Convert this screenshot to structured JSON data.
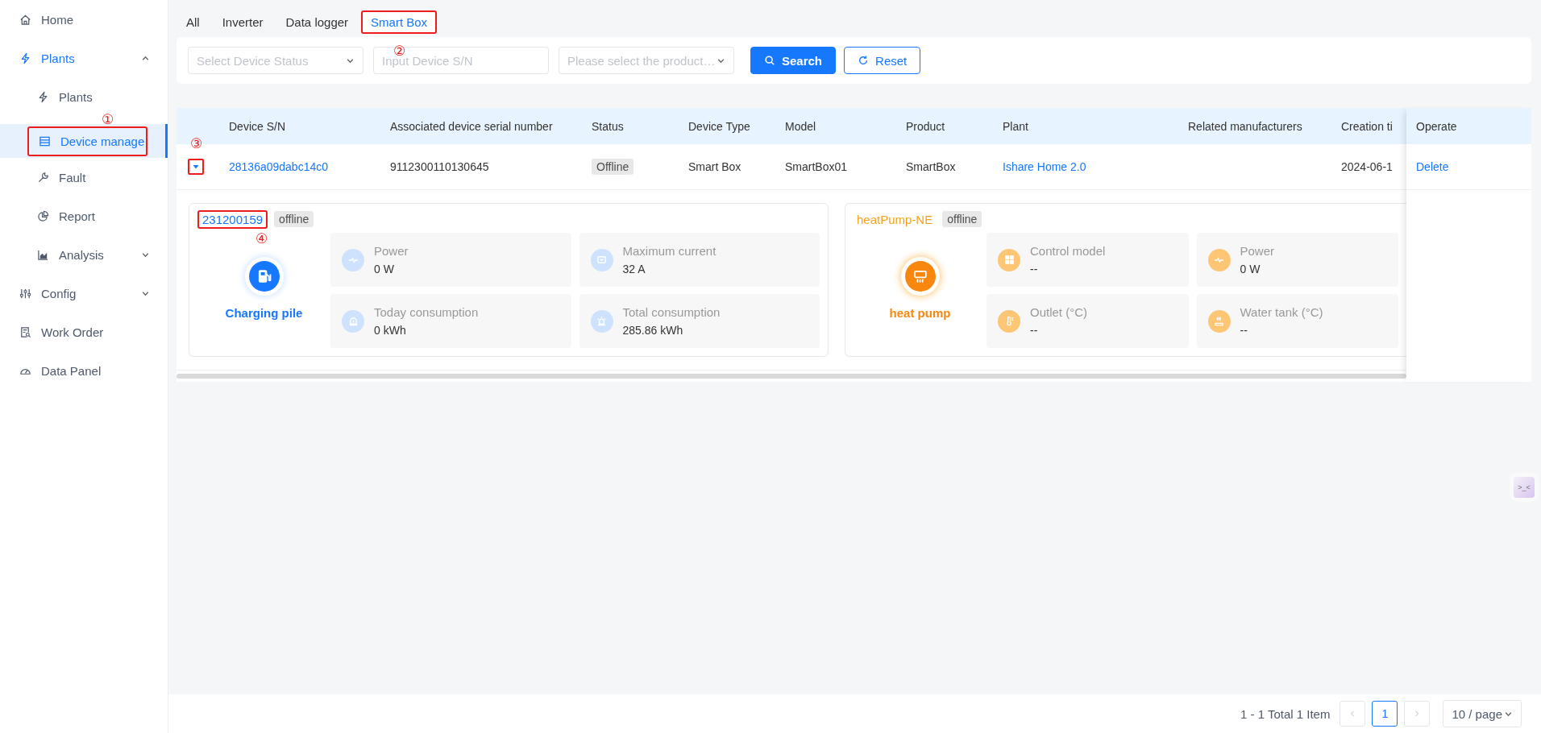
{
  "sidebar": {
    "items": [
      {
        "label": "Home",
        "selected": false
      },
      {
        "label": "Plants",
        "selected": false,
        "expanded": true,
        "children": [
          {
            "label": "Plants",
            "selected": false
          },
          {
            "label": "Device manage",
            "selected": true,
            "callout": "①"
          },
          {
            "label": "Fault",
            "selected": false
          },
          {
            "label": "Report",
            "selected": false
          },
          {
            "label": "Analysis",
            "selected": false,
            "expanded": false
          }
        ]
      },
      {
        "label": "Config",
        "selected": false,
        "expanded": false
      },
      {
        "label": "Work Order",
        "selected": false
      },
      {
        "label": "Data Panel",
        "selected": false
      }
    ]
  },
  "tabs": [
    {
      "label": "All",
      "selected": false
    },
    {
      "label": "Inverter",
      "selected": false
    },
    {
      "label": "Data logger",
      "selected": false
    },
    {
      "label": "Smart Box",
      "selected": true,
      "callout": "②"
    }
  ],
  "filters": [
    {
      "kind": "select",
      "placeholder": "Select Device Status"
    },
    {
      "kind": "input",
      "placeholder": "Input Device S/N"
    },
    {
      "kind": "select",
      "placeholder": "Please select the product…"
    }
  ],
  "buttons": [
    {
      "kind": "primary",
      "label": "Search"
    },
    {
      "kind": "default",
      "label": "Reset"
    }
  ],
  "table": {
    "columns": [
      "Device S/N",
      "Associated device serial number",
      "Status",
      "Device Type",
      "Model",
      "Product",
      "Plant",
      "Related manufacturers",
      "Creation ti"
    ],
    "operate_column": "Operate",
    "rows": [
      {
        "expanded": true,
        "callout": "③",
        "cells": [
          {
            "kind": "link",
            "text": "28136a09dabc14c0"
          },
          {
            "kind": "text",
            "text": "9112300110130645"
          },
          {
            "kind": "tag",
            "text": "Offline"
          },
          {
            "kind": "text",
            "text": "Smart Box"
          },
          {
            "kind": "text",
            "text": "SmartBox01"
          },
          {
            "kind": "text",
            "text": "SmartBox"
          },
          {
            "kind": "link",
            "text": "Ishare Home 2.0"
          },
          {
            "kind": "text",
            "text": ""
          },
          {
            "kind": "text",
            "text": "2024-06-1"
          }
        ],
        "operate": "Delete",
        "devices": [
          {
            "kind": "charger",
            "id": "231200159",
            "callout": "④",
            "status": "offline",
            "label": "Charging pile",
            "metrics": [
              {
                "label": "Power",
                "value": "0 W"
              },
              {
                "label": "Maximum current",
                "value": "32 A"
              },
              {
                "label": "Today consumption",
                "value": "0 kWh"
              },
              {
                "label": "Total consumption",
                "value": "285.86 kWh"
              }
            ]
          },
          {
            "kind": "heat_pump",
            "id": "heatPump-NE",
            "status": "offline",
            "label": "heat pump",
            "metrics": [
              {
                "label": "Control model",
                "value": "--"
              },
              {
                "label": "Power",
                "value": "0 W"
              },
              {
                "label": "Outlet (°C)",
                "value": "--"
              },
              {
                "label": "Water tank (°C)",
                "value": "--"
              }
            ]
          }
        ]
      }
    ]
  },
  "assistant": {
    "label": ">_<"
  },
  "pagination": {
    "summary": "1 - 1 Total 1 Item",
    "pages": [
      {
        "label": "1",
        "selected": true
      }
    ],
    "page_size": "10 / page"
  }
}
